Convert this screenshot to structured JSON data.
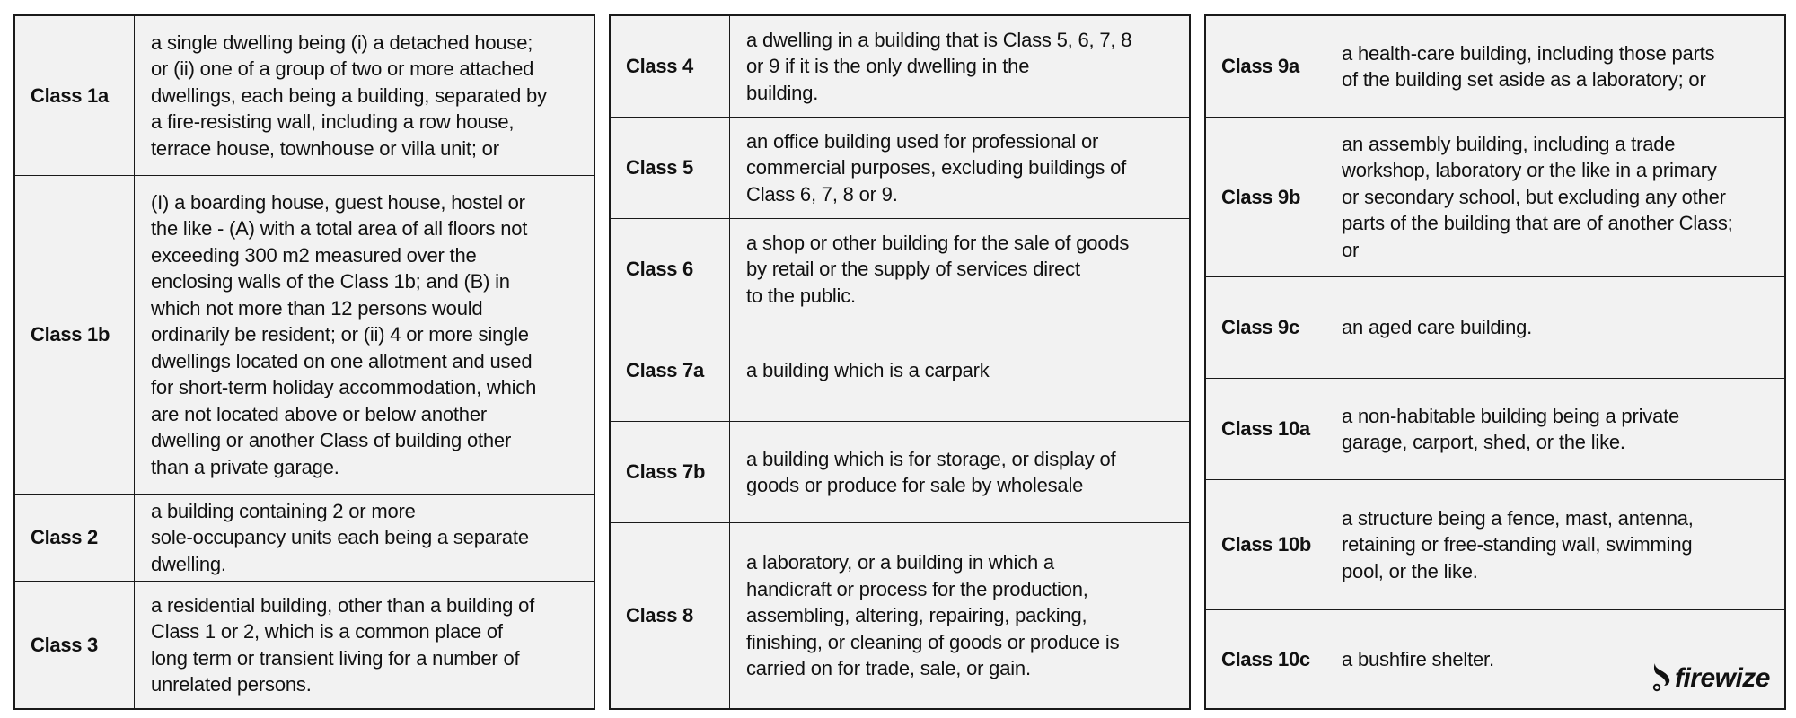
{
  "tables": [
    {
      "rows": [
        {
          "class": "Class 1a",
          "description": "a single dwelling being (i) a detached house;\nor (ii) one of a group of two or more attached\ndwellings, each being a building, separated by\na fire-resisting wall, including a row house,\nterrace house, townhouse or villa unit; or"
        },
        {
          "class": "Class 1b",
          "description": "(I) a boarding house, guest house, hostel or\nthe like - (A) with a total area of all floors not\nexceeding 300 m2 measured over the\nenclosing walls of the Class 1b; and (B) in\nwhich not more than 12 persons would\nordinarily be resident; or (ii) 4 or more single\ndwellings located on one allotment and used\nfor short-term holiday accommodation, which\nare not located above or below another\ndwelling or another Class of building other\nthan a private garage."
        },
        {
          "class": "Class 2",
          "description": "a building containing 2 or more\nsole-occupancy units each being a separate\ndwelling."
        },
        {
          "class": "Class 3",
          "description": "a residential building, other than a building of\nClass 1 or 2, which is a common place of\nlong term or transient living for a number of\nunrelated persons."
        }
      ]
    },
    {
      "rows": [
        {
          "class": "Class 4",
          "description": "a dwelling in a building that is Class 5, 6, 7, 8\nor 9 if it is the only dwelling in the\nbuilding."
        },
        {
          "class": "Class 5",
          "description": "an office building used for professional or\ncommercial purposes, excluding buildings of\nClass 6, 7, 8 or 9."
        },
        {
          "class": "Class 6",
          "description": "a shop or other building for the sale of goods\nby retail or the supply of services direct\nto the public."
        },
        {
          "class": "Class 7a",
          "description": "a building which is a carpark"
        },
        {
          "class": "Class 7b",
          "description": "a building which is for storage, or display of\ngoods or produce for sale by wholesale"
        },
        {
          "class": "Class 8",
          "description": "a laboratory, or a building in which a\nhandicraft or process for the production,\nassembling, altering, repairing, packing,\nfinishing, or cleaning of goods or produce is\ncarried on for trade, sale, or gain."
        }
      ]
    },
    {
      "rows": [
        {
          "class": "Class 9a",
          "description": "a health-care building, including those parts\nof the building set aside as a laboratory; or"
        },
        {
          "class": "Class 9b",
          "description": "an assembly building, including a trade\nworkshop, laboratory or the like in a primary\nor secondary school, but excluding any other\nparts of the building that are of another Class;\nor"
        },
        {
          "class": "Class 9c",
          "description": "an aged care building."
        },
        {
          "class": "Class 10a",
          "description": "a non-habitable building being a private\ngarage, carport, shed, or the like."
        },
        {
          "class": "Class 10b",
          "description": "a structure being a fence, mast, antenna,\nretaining or free-standing wall, swimming\npool, or the like."
        },
        {
          "class": "Class 10c",
          "description": "a bushfire shelter."
        }
      ]
    }
  ],
  "logo": {
    "text": "firewize",
    "icon": "flame-icon"
  },
  "colors": {
    "cell_background": "#f2f2f2",
    "border": "#1a1a1a",
    "text": "#111111"
  }
}
